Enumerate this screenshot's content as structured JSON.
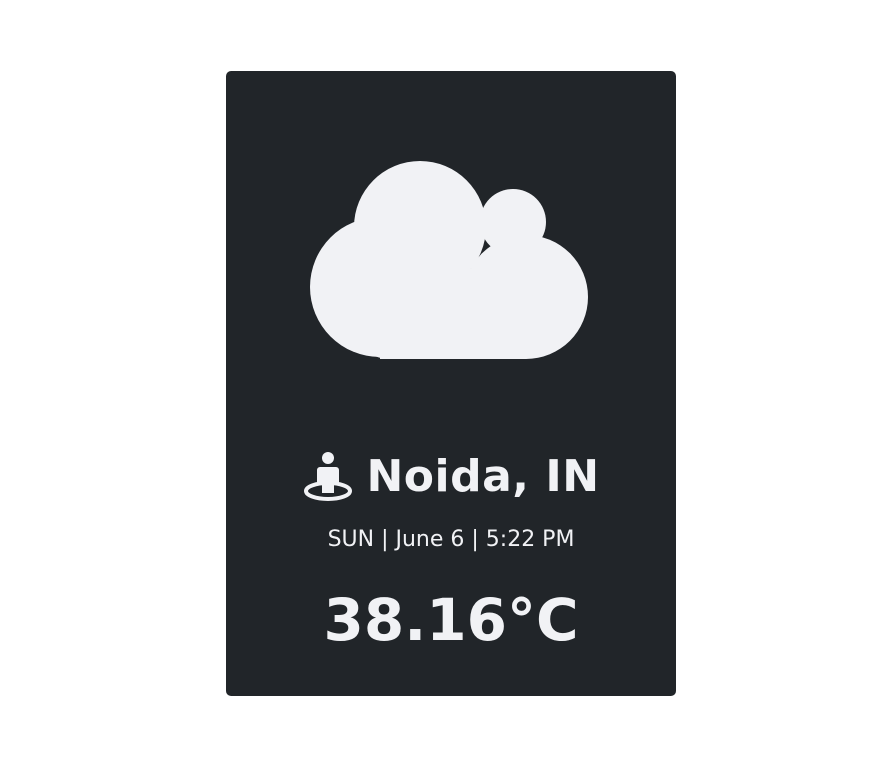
{
  "card": {
    "background": "#212529",
    "foreground": "#f1f2f5"
  },
  "weather": {
    "icon": "cloud-icon",
    "location_icon": "street-view-icon",
    "location": "Noida, IN",
    "datetime": "SUN | June 6 | 5:22 PM",
    "temperature": "38.16°C"
  }
}
